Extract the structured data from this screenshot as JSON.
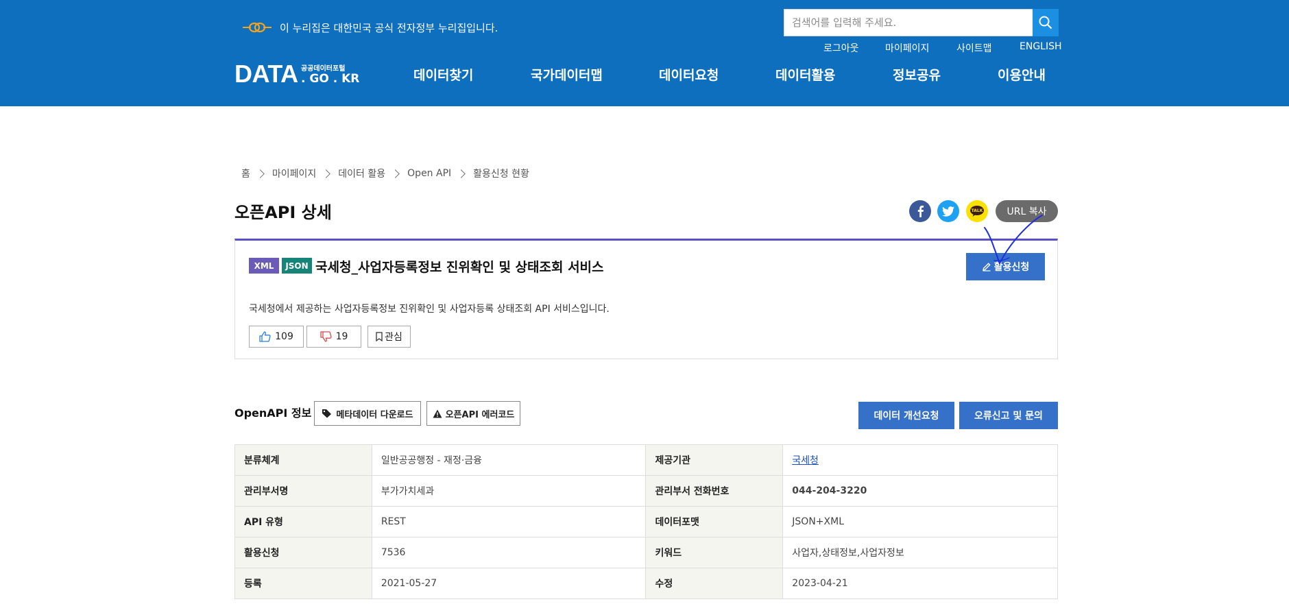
{
  "header": {
    "gov_notice": "이 누리집은 대한민국 공식 전자정부 누리집입니다.",
    "search": {
      "placeholder": "검색어를 입력해 주세요."
    },
    "util_links": [
      "로그아웃",
      "마이페이지",
      "사이트맵",
      "ENGLISH"
    ],
    "brand": {
      "main": "DATA",
      "small": "공공데이터포털",
      "domain": ". GO . KR"
    },
    "nav": [
      "데이터찾기",
      "국가데이터맵",
      "데이터요청",
      "데이터활용",
      "정보공유",
      "이용안내"
    ],
    "colors": {
      "header_bg": "#0f6fbf",
      "accent_blue": "#3671c9",
      "purple_line": "#5a4fc6"
    }
  },
  "breadcrumb": [
    "홈",
    "마이페이지",
    "데이터 활용",
    "Open API",
    "활용신청 현황"
  ],
  "page_title": "오픈API 상세",
  "share": {
    "icons": [
      "facebook-icon",
      "twitter-icon",
      "kakaotalk-icon"
    ],
    "kakao_label": "TALK",
    "url_copy": "URL 복사"
  },
  "summary": {
    "tags": [
      "XML",
      "JSON"
    ],
    "title": "국세청_사업자등록정보 진위확인 및 상태조회 서비스",
    "apply_label": "활용신청",
    "description": "국세청에서 제공하는 사업자등록정보 진위확인 및 사업자등록 상태조회 API 서비스입니다.",
    "likes": "109",
    "dislikes": "19",
    "bookmark_label": "관심"
  },
  "info": {
    "section_title": "OpenAPI 정보",
    "metadata_download": "메타데이터 다운로드",
    "error_code": "오픈API 에러코드",
    "improve_request": "데이터 개선요청",
    "report_inquiry": "오류신고 및 문의",
    "rows": [
      {
        "k1": "분류체계",
        "v1": "일반공공행정 - 재정·금융",
        "k2": "제공기관",
        "v2": "국세청"
      },
      {
        "k1": "관리부서명",
        "v1": "부가가치세과",
        "k2": "관리부서 전화번호",
        "v2": "044-204-3220"
      },
      {
        "k1": "API 유형",
        "v1": "REST",
        "k2": "데이터포맷",
        "v2": "JSON+XML"
      },
      {
        "k1": "활용신청",
        "v1": "7536",
        "k2": "키워드",
        "v2": "사업자,상태정보,사업자정보"
      },
      {
        "k1": "등록",
        "v1": "2021-05-27",
        "k2": "수정",
        "v2": "2023-04-21"
      }
    ]
  }
}
